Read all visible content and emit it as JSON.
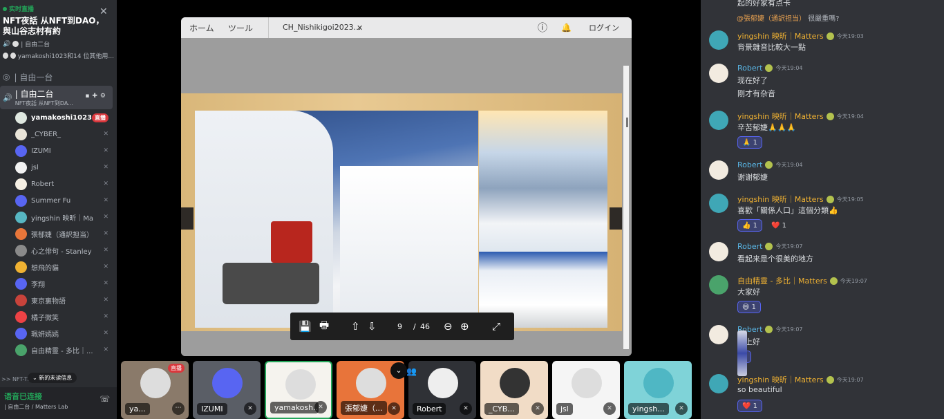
{
  "event": {
    "live_label": "实时直播",
    "title": "NFT夜話 从NFT到DAO，與山谷志村有約",
    "channel_line": "| 自由二台",
    "participants_line": "yamakoshi1023和14 位其他用..."
  },
  "channels": {
    "ch1_label": "| 自由一台",
    "ch2_label": "| 自由二台",
    "ch2_sub": "NFT夜話 从NFT到DA..."
  },
  "voice_users": [
    {
      "name": "yamakoshi1023",
      "badge": "直播",
      "color": "#dfe8e0"
    },
    {
      "name": "_CYBER_",
      "color": "#e9e4d8"
    },
    {
      "name": "IZUMI",
      "color": "#5865f2"
    },
    {
      "name": "jsl",
      "color": "#f2f2f2"
    },
    {
      "name": "Robert",
      "color": "#f5efe4"
    },
    {
      "name": "Summer Fu",
      "color": "#5865f2"
    },
    {
      "name": "yingshin 映昕｜Ma...",
      "color": "#57b7c3"
    },
    {
      "name": "張郁婕（通訳担当）",
      "color": "#e8763a"
    },
    {
      "name": "心之俳句 - Stanley",
      "color": "#8a8a8a"
    },
    {
      "name": "想飛的貓",
      "color": "#f0b232"
    },
    {
      "name": "李翔",
      "color": "#5865f2"
    },
    {
      "name": "東京裏物語",
      "color": "#c8433b"
    },
    {
      "name": "橘子微笑",
      "color": "#ed4245"
    },
    {
      "name": "珮妍嫣嫣",
      "color": "#5865f2"
    },
    {
      "name": "自由精靈 - 多比｜...",
      "color": "#4aa36b"
    }
  ],
  "sidebar_footer": {
    "nft_label": ">> NFT-TI",
    "unread_label": "新的未读信息",
    "status": "语音已连接",
    "status_sub": "| 自由二台 / Matters Lab"
  },
  "viewer": {
    "tab_home": "ホーム",
    "tab_tool": "ツール",
    "doc_tab": "CH_Nishikigoi2023...",
    "login": "ログイン",
    "page_current": "9",
    "page_sep": "/",
    "page_total": "46",
    "streamer": "yamakoshi1023"
  },
  "tiles": [
    {
      "label": "ya...",
      "bg": "#8a7a6a",
      "live": "直播"
    },
    {
      "label": "IZUMI",
      "bg": "#5a5e66"
    },
    {
      "label": "yamakosh...",
      "bg": "#f5f3ee"
    },
    {
      "label": "張郁婕（...",
      "bg": "#e8743a"
    },
    {
      "label": "Robert",
      "bg": "#2f3136"
    },
    {
      "label": "_CYB...",
      "bg": "#f1dcc6"
    },
    {
      "label": "jsl",
      "bg": "#f5f5f5"
    },
    {
      "label": "yingsh...",
      "bg": "#7fd3d8"
    }
  ],
  "chat": {
    "top_text": "起的好家有点卡",
    "messages": [
      {
        "name": "yingshin 映昕｜Matters",
        "time": "今天19:03",
        "reply_to": "@張郁婕（通訳担当）",
        "reply_text": "很嚴重嗎?",
        "lines": [
          "背景雜音比較大一點"
        ],
        "color": "#f0b232"
      },
      {
        "name": "Robert",
        "time": "今天19:04",
        "lines": [
          "现在好了",
          "刚才有杂音"
        ],
        "color": "#5ab8e8"
      },
      {
        "name": "yingshin 映昕｜Matters",
        "time": "今天19:04",
        "lines": [
          "辛苦郁婕🙏🙏🙏"
        ],
        "react": "🙏 1",
        "color": "#f0b232"
      },
      {
        "name": "Robert",
        "time": "今天19:04",
        "lines": [
          "谢谢郁婕"
        ],
        "color": "#5ab8e8"
      },
      {
        "name": "yingshin 映昕｜Matters",
        "time": "今天19:05",
        "lines": [
          "喜歡「關係人口」這個分類👍"
        ],
        "react": "👍 1",
        "react2": "❤️ 1",
        "color": "#f0b232"
      },
      {
        "name": "Robert",
        "time": "今天19:07",
        "lines": [
          "看起来是个很美的地方"
        ],
        "color": "#5ab8e8"
      },
      {
        "name": "自由精靈 - 多比｜Matters",
        "time": "今天19:07",
        "lines": [
          "大家好"
        ],
        "react": "😄 1",
        "color": "#f0b232"
      },
      {
        "name": "Robert",
        "time": "今天19:07",
        "lines": [
          "晚上好"
        ],
        "react": "1",
        "color": "#5ab8e8"
      },
      {
        "name": "yingshin 映昕｜Matters",
        "time": "今天19:07",
        "lines": [
          "so beautiful"
        ],
        "react": "❤️ 1",
        "color": "#f0b232"
      }
    ]
  }
}
